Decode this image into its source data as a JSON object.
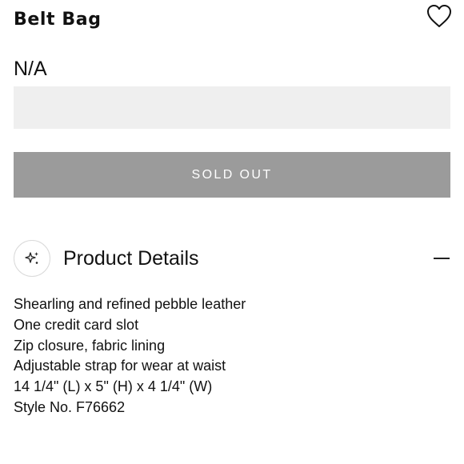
{
  "product": {
    "title": "Belt Bag",
    "price": "N/A",
    "sold_out_label": "SOLD OUT"
  },
  "icons": {
    "favorite": "heart-icon",
    "details": "sparkle-icon",
    "collapse": "minus-icon"
  },
  "details": {
    "heading": "Product Details",
    "items": [
      "Shearling and refined pebble leather",
      "One credit card slot",
      "Zip closure, fabric lining",
      "Adjustable strap for wear at waist",
      "14 1/4\" (L) x 5\" (H) x 4 1/4\" (W)",
      "Style No. F76662"
    ]
  },
  "colors": {
    "sold_out_button": "#9b9b9b",
    "placeholder_box": "#efefef",
    "text": "#111111"
  }
}
